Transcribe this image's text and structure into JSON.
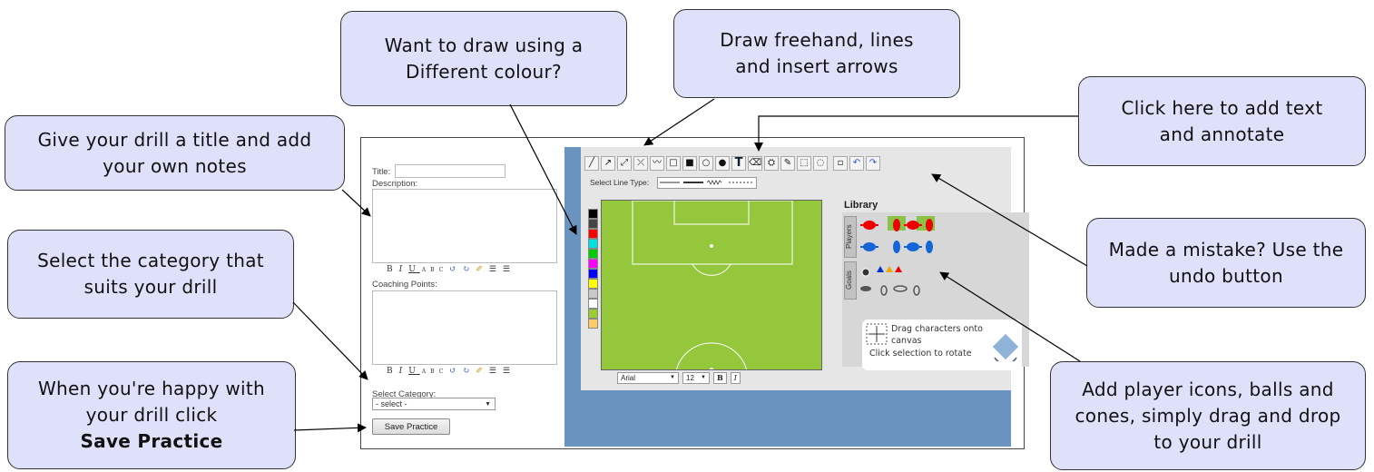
{
  "callouts": {
    "title_notes": "Give your drill a title and add your own notes",
    "colour": "Want to draw using a Different colour?",
    "freehand": "Draw freehand, lines and insert arrows",
    "text": "Click here to add text and annotate",
    "undo": "Made a mistake? Use the undo button",
    "category": "Select the category that suits your drill",
    "save_line1": "When you're happy with your drill click",
    "save_line2": "Save Practice",
    "players": "Add player icons, balls and cones, simply drag and drop to your drill"
  },
  "form": {
    "title_label": "Title:",
    "description_label": "Description:",
    "coaching_label": "Coaching Points:",
    "category_label": "Select Category:",
    "category_value": "- select -",
    "save_button": "Save Practice"
  },
  "editor": {
    "line_type_label": "Select Line Type:",
    "font_name": "Arial",
    "font_size": "12",
    "bold": "B",
    "italic": "I",
    "library_title": "Library",
    "tab_players": "Players",
    "tab_goals": "Goals",
    "hint_line1": "Drag characters onto",
    "hint_line2": "canvas",
    "hint_line3": "Click selection to rotate"
  },
  "colors": {
    "callout_fill": "#dfe1fb",
    "pitch": "#95c73c",
    "editor_bg": "#6b93c0",
    "palette": [
      "#000000",
      "#444444",
      "#ff0000",
      "#00e0e0",
      "#00cc00",
      "#ff00ff",
      "#0000ff",
      "#ffff00",
      "#c8c8c8",
      "#ffffff",
      "#99cc33",
      "#ffcc66"
    ]
  }
}
